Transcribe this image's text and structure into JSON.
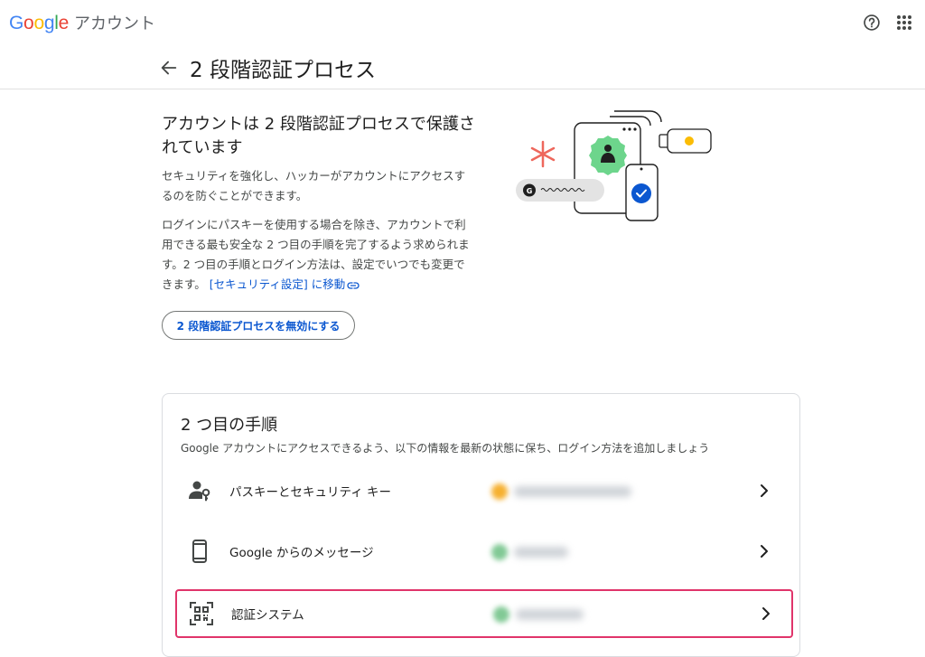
{
  "header": {
    "logo_text": "Google",
    "product": "アカウント",
    "help_icon": "help-circle-icon",
    "apps_icon": "apps-grid-icon"
  },
  "page": {
    "title": "2 段階認証プロセス"
  },
  "hero": {
    "heading": "アカウントは 2 段階認証プロセスで保護されています",
    "para1": "セキュリティを強化し、ハッカーがアカウントにアクセスするのを防ぐことができます。",
    "para2": "ログインにパスキーを使用する場合を除き、アカウントで利用できる最も安全な 2 つ目の手順を完了するよう求められます。2 つ目の手順とログイン方法は、設定でいつでも変更できます。",
    "link": "[セキュリティ設定] に移動",
    "disable_button": "2 段階認証プロセスを無効にする"
  },
  "second_steps": {
    "heading": "2 つ目の手順",
    "subtitle": "Google アカウントにアクセスできるよう、以下の情報を最新の状態に保ち、ログイン方法を追加しましょう",
    "items": [
      {
        "label": "パスキーとセキュリティ キー",
        "icon": "person-key-icon",
        "status_color": "#f6b030"
      },
      {
        "label": "Google からのメッセージ",
        "icon": "smartphone-icon",
        "status_color": "#81c995"
      },
      {
        "label": "認証システム",
        "icon": "qr-code-icon",
        "status_color": "#81c995"
      }
    ]
  },
  "colors": {
    "accent": "#0b57d0",
    "highlight": "#e0346a",
    "text": "#1f1f1f"
  }
}
